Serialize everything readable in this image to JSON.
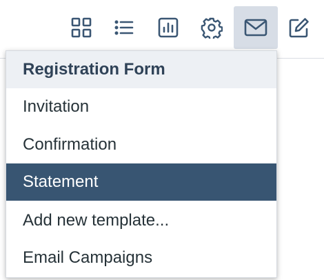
{
  "toolbar": {
    "accent_color": "#3a5673",
    "active_bg": "#d7dde6",
    "buttons": [
      {
        "icon": "grid-icon",
        "active": false
      },
      {
        "icon": "list-icon",
        "active": false
      },
      {
        "icon": "bar-chart-icon",
        "active": false
      },
      {
        "icon": "gear-icon",
        "active": false
      },
      {
        "icon": "mail-icon",
        "active": true
      },
      {
        "icon": "edit-icon",
        "active": false
      }
    ]
  },
  "menu": {
    "header": "Registration Form",
    "items": [
      {
        "label": "Invitation",
        "selected": false
      },
      {
        "label": "Confirmation",
        "selected": false
      },
      {
        "label": "Statement",
        "selected": true
      },
      {
        "label": "Add new template...",
        "selected": false
      },
      {
        "label": "Email Campaigns",
        "selected": false
      }
    ],
    "selected_color": "#385572"
  }
}
